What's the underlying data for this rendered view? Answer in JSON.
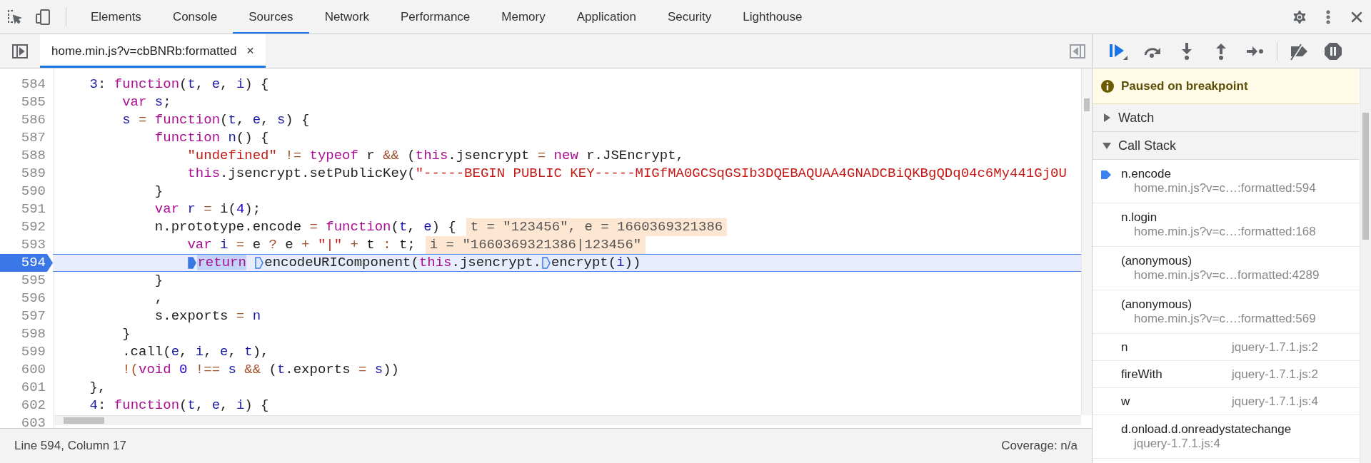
{
  "devtools_tabs": [
    {
      "label": "Elements",
      "selected": false
    },
    {
      "label": "Console",
      "selected": false
    },
    {
      "label": "Sources",
      "selected": true
    },
    {
      "label": "Network",
      "selected": false
    },
    {
      "label": "Performance",
      "selected": false
    },
    {
      "label": "Memory",
      "selected": false
    },
    {
      "label": "Application",
      "selected": false
    },
    {
      "label": "Security",
      "selected": false
    },
    {
      "label": "Lighthouse",
      "selected": false
    }
  ],
  "editor": {
    "file_tab": {
      "label": "home.min.js?v=cbBNRb:formatted",
      "selected": true,
      "close_glyph": "×"
    },
    "lines": [
      {
        "number": "584",
        "selected": false,
        "tokens": [
          {
            "text": "    3",
            "kind": "variable"
          },
          {
            "text": ": ",
            "kind": "plain"
          },
          {
            "text": "function",
            "kind": "keyword"
          },
          {
            "text": "(",
            "kind": "plain"
          },
          {
            "text": "t",
            "kind": "variable"
          },
          {
            "text": ", ",
            "kind": "plain"
          },
          {
            "text": "e",
            "kind": "variable"
          },
          {
            "text": ", ",
            "kind": "plain"
          },
          {
            "text": "i",
            "kind": "variable"
          },
          {
            "text": ") {",
            "kind": "plain"
          }
        ]
      },
      {
        "number": "585",
        "selected": false,
        "tokens": [
          {
            "text": "        var",
            "kind": "keyword"
          },
          {
            "text": " s",
            "kind": "variable"
          },
          {
            "text": ";",
            "kind": "plain"
          }
        ]
      },
      {
        "number": "586",
        "selected": false,
        "tokens": [
          {
            "text": "        s",
            "kind": "variable"
          },
          {
            "text": " =",
            "kind": "operator"
          },
          {
            "text": " function",
            "kind": "keyword"
          },
          {
            "text": "(",
            "kind": "plain"
          },
          {
            "text": "t",
            "kind": "variable"
          },
          {
            "text": ", ",
            "kind": "plain"
          },
          {
            "text": "e",
            "kind": "variable"
          },
          {
            "text": ", ",
            "kind": "plain"
          },
          {
            "text": "s",
            "kind": "variable"
          },
          {
            "text": ") {",
            "kind": "plain"
          }
        ]
      },
      {
        "number": "587",
        "selected": false,
        "tokens": [
          {
            "text": "            function",
            "kind": "keyword"
          },
          {
            "text": " n",
            "kind": "variable"
          },
          {
            "text": "() {",
            "kind": "plain"
          }
        ]
      },
      {
        "number": "588",
        "selected": false,
        "tokens": [
          {
            "text": "                \"undefined\"",
            "kind": "string"
          },
          {
            "text": " !=",
            "kind": "operator"
          },
          {
            "text": " typeof",
            "kind": "keyword"
          },
          {
            "text": " r ",
            "kind": "plain"
          },
          {
            "text": "&&",
            "kind": "operator"
          },
          {
            "text": " (",
            "kind": "plain"
          },
          {
            "text": "this",
            "kind": "keyword"
          },
          {
            "text": ".jsencrypt ",
            "kind": "plain"
          },
          {
            "text": "=",
            "kind": "operator"
          },
          {
            "text": " new",
            "kind": "keyword"
          },
          {
            "text": " r.JSEncrypt,",
            "kind": "plain"
          }
        ]
      },
      {
        "number": "589",
        "selected": false,
        "tokens": [
          {
            "text": "                this",
            "kind": "keyword"
          },
          {
            "text": ".jsencrypt.setPublicKey(",
            "kind": "plain"
          },
          {
            "text": "\"-----BEGIN PUBLIC KEY-----MIGfMA0GCSqGSIb3DQEBAQUAA4GNADCBiQKBgQDq04c6My441Gj0U",
            "kind": "string"
          }
        ]
      },
      {
        "number": "590",
        "selected": false,
        "tokens": [
          {
            "text": "            }",
            "kind": "plain"
          }
        ]
      },
      {
        "number": "591",
        "selected": false,
        "tokens": [
          {
            "text": "            var",
            "kind": "keyword"
          },
          {
            "text": " r",
            "kind": "variable"
          },
          {
            "text": " =",
            "kind": "operator"
          },
          {
            "text": " i(",
            "kind": "plain"
          },
          {
            "text": "4",
            "kind": "number"
          },
          {
            "text": ");",
            "kind": "plain"
          }
        ]
      },
      {
        "number": "592",
        "selected": false,
        "inline_value": "t = \"123456\", e = 1660369321386",
        "tokens": [
          {
            "text": "            n.prototype.encode ",
            "kind": "plain"
          },
          {
            "text": "=",
            "kind": "operator"
          },
          {
            "text": " function",
            "kind": "keyword"
          },
          {
            "text": "(",
            "kind": "plain"
          },
          {
            "text": "t",
            "kind": "variable"
          },
          {
            "text": ", ",
            "kind": "plain"
          },
          {
            "text": "e",
            "kind": "variable"
          },
          {
            "text": ") {",
            "kind": "plain"
          }
        ]
      },
      {
        "number": "593",
        "selected": false,
        "inline_value": "i = \"1660369321386|123456\"",
        "tokens": [
          {
            "text": "                var",
            "kind": "keyword"
          },
          {
            "text": " i",
            "kind": "variable"
          },
          {
            "text": " =",
            "kind": "operator"
          },
          {
            "text": " e ",
            "kind": "plain"
          },
          {
            "text": "?",
            "kind": "operator"
          },
          {
            "text": " e ",
            "kind": "plain"
          },
          {
            "text": "+",
            "kind": "operator"
          },
          {
            "text": " \"|\"",
            "kind": "string"
          },
          {
            "text": " +",
            "kind": "operator"
          },
          {
            "text": " t ",
            "kind": "plain"
          },
          {
            "text": ":",
            "kind": "operator"
          },
          {
            "text": " t;",
            "kind": "plain"
          }
        ]
      },
      {
        "number": "594",
        "selected": true,
        "tokens": [
          {
            "text": "                return",
            "kind": "keyword",
            "marker": true,
            "highlighted": true
          },
          {
            "text": " encodeURIComponent",
            "kind": "plain",
            "marker": true,
            "highlighted": false
          },
          {
            "text": "(",
            "kind": "plain"
          },
          {
            "text": "this",
            "kind": "keyword"
          },
          {
            "text": ".jsencrypt.",
            "kind": "plain"
          },
          {
            "text": "encrypt",
            "kind": "plain",
            "marker": true,
            "highlighted": false
          },
          {
            "text": "(",
            "kind": "plain"
          },
          {
            "text": "i",
            "kind": "variable"
          },
          {
            "text": "))",
            "kind": "plain"
          }
        ]
      },
      {
        "number": "595",
        "selected": false,
        "tokens": [
          {
            "text": "            }",
            "kind": "plain"
          }
        ]
      },
      {
        "number": "596",
        "selected": false,
        "tokens": [
          {
            "text": "            ,",
            "kind": "plain"
          }
        ]
      },
      {
        "number": "597",
        "selected": false,
        "tokens": [
          {
            "text": "            s.exports ",
            "kind": "plain"
          },
          {
            "text": "=",
            "kind": "operator"
          },
          {
            "text": " n",
            "kind": "variable"
          }
        ]
      },
      {
        "number": "598",
        "selected": false,
        "tokens": [
          {
            "text": "        }",
            "kind": "plain"
          }
        ]
      },
      {
        "number": "599",
        "selected": false,
        "tokens": [
          {
            "text": "        .call(",
            "kind": "plain"
          },
          {
            "text": "e",
            "kind": "variable"
          },
          {
            "text": ", ",
            "kind": "plain"
          },
          {
            "text": "i",
            "kind": "variable"
          },
          {
            "text": ", ",
            "kind": "plain"
          },
          {
            "text": "e",
            "kind": "variable"
          },
          {
            "text": ", ",
            "kind": "plain"
          },
          {
            "text": "t",
            "kind": "variable"
          },
          {
            "text": "),",
            "kind": "plain"
          }
        ]
      },
      {
        "number": "600",
        "selected": false,
        "tokens": [
          {
            "text": "        !(",
            "kind": "operator"
          },
          {
            "text": "void",
            "kind": "keyword"
          },
          {
            "text": " 0",
            "kind": "number"
          },
          {
            "text": " !==",
            "kind": "operator"
          },
          {
            "text": " s",
            "kind": "variable"
          },
          {
            "text": " &&",
            "kind": "operator"
          },
          {
            "text": " (",
            "kind": "plain"
          },
          {
            "text": "t",
            "kind": "variable"
          },
          {
            "text": ".exports ",
            "kind": "plain"
          },
          {
            "text": "=",
            "kind": "operator"
          },
          {
            "text": " s",
            "kind": "variable"
          },
          {
            "text": "))",
            "kind": "plain"
          }
        ]
      },
      {
        "number": "601",
        "selected": false,
        "tokens": [
          {
            "text": "    },",
            "kind": "plain"
          }
        ]
      },
      {
        "number": "602",
        "selected": false,
        "tokens": [
          {
            "text": "    4",
            "kind": "variable"
          },
          {
            "text": ": ",
            "kind": "plain"
          },
          {
            "text": "function",
            "kind": "keyword"
          },
          {
            "text": "(",
            "kind": "plain"
          },
          {
            "text": "t",
            "kind": "variable"
          },
          {
            "text": ", ",
            "kind": "plain"
          },
          {
            "text": "e",
            "kind": "variable"
          },
          {
            "text": ", ",
            "kind": "plain"
          },
          {
            "text": "i",
            "kind": "variable"
          },
          {
            "text": ") {",
            "kind": "plain"
          }
        ]
      },
      {
        "number": "603",
        "selected": false
      }
    ]
  },
  "status_bar": {
    "position": "Line 594, Column 17",
    "coverage": "Coverage: n/a"
  },
  "debugger": {
    "banner": "Paused on breakpoint",
    "sections": [
      {
        "label": "Watch",
        "expanded": false
      },
      {
        "label": "Call Stack",
        "expanded": true
      }
    ],
    "call_stack": [
      {
        "name": "n.encode",
        "location": "home.min.js?v=c…:formatted:594",
        "selected": true,
        "kind": "wrapped"
      },
      {
        "name": "n.login",
        "location": "home.min.js?v=c…:formatted:168",
        "selected": false,
        "kind": "wrapped"
      },
      {
        "name": "(anonymous)",
        "location": "home.min.js?v=c…formatted:4289",
        "selected": false,
        "kind": "wrapped"
      },
      {
        "name": "(anonymous)",
        "location": "home.min.js?v=c…:formatted:569",
        "selected": false,
        "kind": "wrapped"
      },
      {
        "name": "n",
        "location": "jquery-1.7.1.js:2",
        "selected": false,
        "kind": "inline"
      },
      {
        "name": "fireWith",
        "location": "jquery-1.7.1.js:2",
        "selected": false,
        "kind": "inline"
      },
      {
        "name": "w",
        "location": "jquery-1.7.1.js:4",
        "selected": false,
        "kind": "inline"
      },
      {
        "name": "d.onload.d.onreadystatechange",
        "location": "jquery-1.7.1.js:4",
        "selected": false,
        "kind": "wrapped"
      }
    ]
  }
}
